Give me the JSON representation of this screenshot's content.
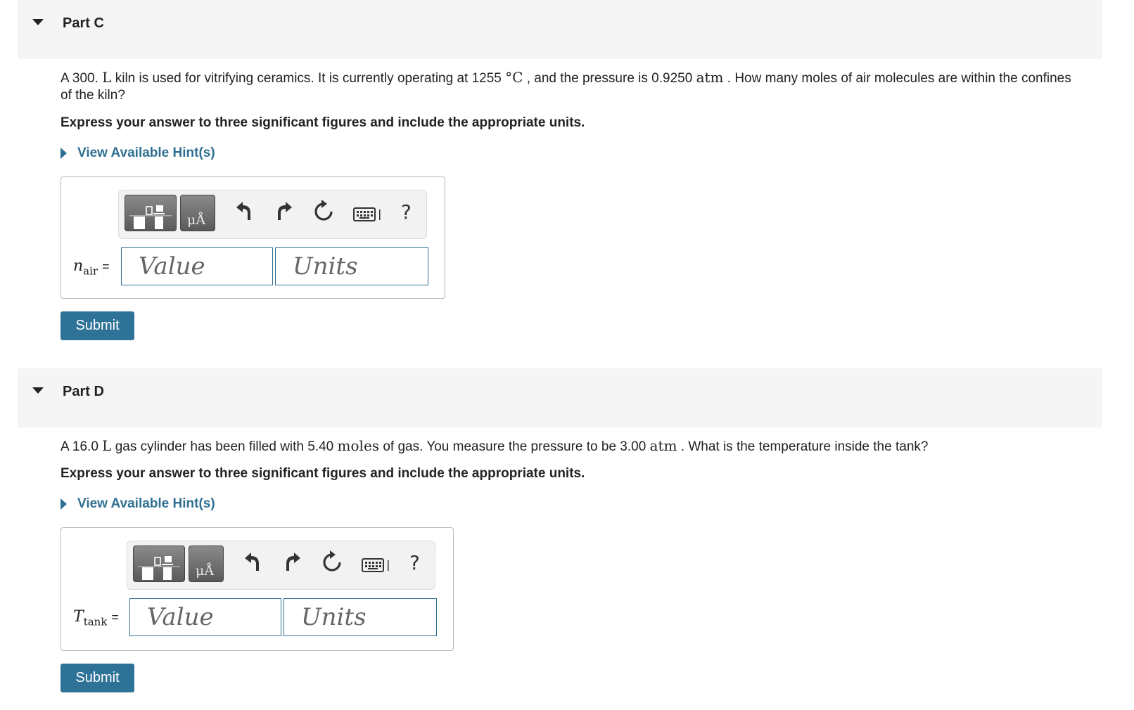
{
  "part_c": {
    "title": "Part C",
    "question": {
      "t1": "A 300. ",
      "m1": "L",
      "t2": " kiln is used for vitrifying ceramics. It is currently operating at 1255 ",
      "m2": "°C",
      "t3": " , and the pressure is 0.9250 ",
      "m3": "atm",
      "t4": " . How many moles of air molecules are within the confines of the kiln?"
    },
    "instruction": "Express your answer to three significant figures and include the appropriate units.",
    "hint_link": "View Available Hint(s)",
    "toolbar": {
      "units_button_glyph": "μÅ",
      "help_label": "?"
    },
    "variable": {
      "symbol": "n",
      "subscript": "air",
      "equals": "="
    },
    "value_placeholder": "Value",
    "units_placeholder": "Units",
    "submit_label": "Submit"
  },
  "part_d": {
    "title": "Part D",
    "question": {
      "t1": "A 16.0 ",
      "m1": "L",
      "t2": " gas cylinder has been filled with 5.40 ",
      "m2": "moles",
      "t3": " of gas. You measure the pressure to be 3.00 ",
      "m3": "atm",
      "t4": " . What is the temperature inside the tank?"
    },
    "instruction": "Express your answer to three significant figures and include the appropriate units.",
    "hint_link": "View Available Hint(s)",
    "toolbar": {
      "units_button_glyph": "μÅ",
      "help_label": "?"
    },
    "variable": {
      "symbol": "T",
      "subscript": "tank",
      "equals": "="
    },
    "value_placeholder": "Value",
    "units_placeholder": "Units",
    "submit_label": "Submit"
  },
  "colors": {
    "accent": "#2e7397",
    "link": "#2f6f91",
    "header_bg": "#f5f5f5"
  },
  "icons": [
    "collapse-caret-icon",
    "templates-icon",
    "units-icon",
    "undo-icon",
    "redo-icon",
    "reset-icon",
    "keyboard-icon",
    "help-icon"
  ]
}
